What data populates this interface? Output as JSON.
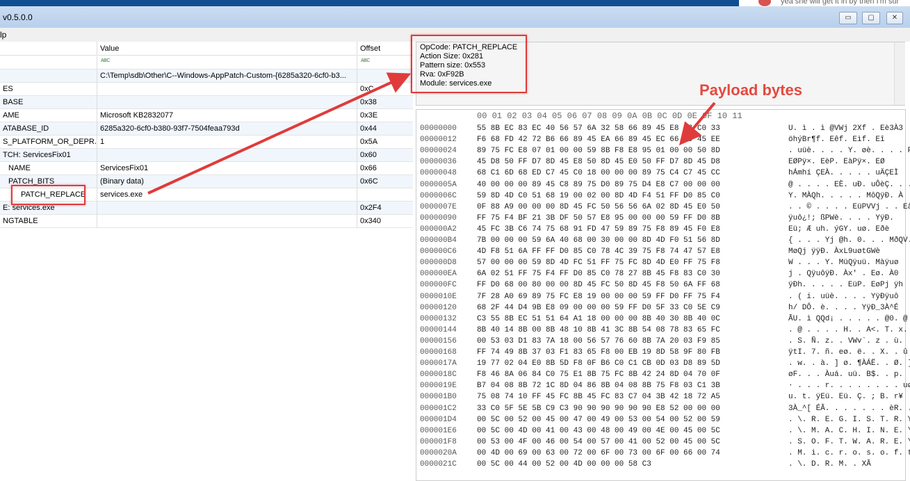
{
  "window": {
    "title": "v0.5.0.0",
    "chat_snippet": "yea she will get it in by then I'm sur",
    "buttons": {
      "minimize": "▭",
      "maximize": "▢",
      "close": "✕"
    }
  },
  "menu": {
    "help": "lp"
  },
  "grid": {
    "headers": {
      "name": "",
      "value": "Value",
      "offset": "Offset"
    },
    "rows": [
      {
        "name": "",
        "value": "",
        "value_icon": "abc-icon",
        "offset": "",
        "offset_icon": "abc-icon"
      },
      {
        "name": "",
        "value": "C:\\Temp\\sdb\\Other\\C--Windows-AppPatch-Custom-{6285a320-6cf0-b3...",
        "offset": ""
      },
      {
        "name": "ES",
        "value": "",
        "offset": "0xC"
      },
      {
        "name": "BASE",
        "value": "",
        "offset": "0x38"
      },
      {
        "name": "AME",
        "value": "Microsoft KB2832077",
        "offset": "0x3E"
      },
      {
        "name": "ATABASE_ID",
        "value": "6285a320-6cf0-b380-93f7-7504feaa793d",
        "offset": "0x44"
      },
      {
        "name": "S_PLATFORM_OR_DEPR...",
        "value": "1",
        "offset": "0x5A"
      },
      {
        "name": "TCH: ServicesFix01",
        "value": "",
        "offset": "0x60"
      },
      {
        "name": "NAME",
        "value": "ServicesFix01",
        "offset": "0x66"
      },
      {
        "name": "PATCH_BITS",
        "value": "(Binary data)",
        "offset": "0x6C"
      },
      {
        "name": "PATCH_REPLACE",
        "value": "services.exe",
        "offset": ""
      },
      {
        "name": "E: services.exe",
        "value": "",
        "offset": "0x2F4"
      },
      {
        "name": "NGTABLE",
        "value": "",
        "offset": "0x340"
      }
    ]
  },
  "info": {
    "lines": [
      "OpCode: PATCH_REPLACE",
      "Action Size: 0x281",
      "Pattern size: 0x553",
      "Rva: 0xF92B",
      "Module: services.exe"
    ]
  },
  "annotation": {
    "payload_label": "Payload bytes"
  },
  "hex": {
    "col_header": "00 01 02 03 04 05 06 07 08 09 0A 0B 0C 0D 0E 0F 10 11",
    "rows": [
      {
        "addr": "00000000",
        "bytes": "55 8B EC 83 EC 40 56 57 6A 32 58 66 89 45 E8 33 C0 33",
        "ascii": "U. ì . ì @VWj 2Xf . Eè3À3"
      },
      {
        "addr": "00000012",
        "bytes": "F6 68 FD 42 72 B6 66 89 45 EA 66 89 45 EC 66 89 45 EE",
        "ascii": "öhýBr¶f. Eêf. Eìf. Eî"
      },
      {
        "addr": "00000024",
        "bytes": "89 75 FC E8 07 01 00 00 59 8B F8 E8 95 01 00 00 50 8D",
        "ascii": ". uüè. . . . Y. øè. . . . P."
      },
      {
        "addr": "00000036",
        "bytes": "45 D8 50 FF D7 8D 45 E8 50 8D 45 E0 50 FF D7 8D 45 D8",
        "ascii": "EØPÿ×. EèP. EàPÿ×. EØ"
      },
      {
        "addr": "00000048",
        "bytes": "68 C1 6D 68 ED C7 45 C0 18 00 00 00 89 75 C4 C7 45 CC",
        "ascii": "hÁmhí ÇEÀ. . . . . uÄÇEÌ"
      },
      {
        "addr": "0000005A",
        "bytes": "40 00 00 00 89 45 C8 89 75 D0 89 75 D4 E8 C7 00 00 00",
        "ascii": "@ . . . . EÈ. uÐ. uÔèÇ. . ."
      },
      {
        "addr": "0000006C",
        "bytes": "59 8D 4D C0 51 68 19 00 02 00 8D 4D F4 51 FF D0 85 C0",
        "ascii": "Y. MÀQh. . . . . MôQÿÐ. À"
      },
      {
        "addr": "0000007E",
        "bytes": "0F 88 A9 00 00 00 8D 45 FC 50 56 56 6A 02 8D 45 E0 50",
        "ascii": ". . © . . . . EüPVVj . . EàP"
      },
      {
        "addr": "00000090",
        "bytes": "FF 75 F4 BF 21 3B DF 50 57 E8 95 00 00 00 59 FF D0 8B",
        "ascii": "ÿuô¿!; ßPWè. . . . YÿÐ."
      },
      {
        "addr": "000000A2",
        "bytes": "45 FC 3B C6 74 75 68 91 FD 47 59 89 75 F8 89 45 F0 E8",
        "ascii": "Eü; Æ uh. ýGY. uø. Eðè"
      },
      {
        "addr": "000000B4",
        "bytes": "7B 00 00 00 59 6A 40 68 00 30 00 00 8D 4D F0 51 56 8D",
        "ascii": "{ . . . Yj @h. 0. . . MðQV."
      },
      {
        "addr": "000000C6",
        "bytes": "4D F8 51 6A FF FF D0 85 C0 78 4C 39 75 F8 74 47 57 E8",
        "ascii": "MøQj ÿÿÐ. ÀxL9uøtGWè"
      },
      {
        "addr": "000000D8",
        "bytes": "57 00 00 00 59 8D 4D FC 51 FF 75 FC 8D 4D E0 FF 75 F8",
        "ascii": "W . . . Y. MüQÿuü. Màÿuø"
      },
      {
        "addr": "000000EA",
        "bytes": "6A 02 51 FF 75 F4 FF D0 85 C0 78 27 8B 45 F8 83 C0 30",
        "ascii": "j . QÿuôÿÐ. Àx' . Eø. À0"
      },
      {
        "addr": "000000FC",
        "bytes": "FF D0 68 00 80 00 00 8D 45 FC 50 8D 45 F8 50 6A FF 68",
        "ascii": "ÿÐh. . . . . EüP. EøPj ÿh"
      },
      {
        "addr": "0000010E",
        "bytes": "7F 28 A0 69 89 75 FC E8 19 00 00 00 59 FF D0 FF 75 F4",
        "ascii": ". ( i. uüè. . . . YÿÐÿuô"
      },
      {
        "addr": "00000120",
        "bytes": "68 2F 44 D4 9B E8 09 00 00 00 59 FF D0 5F 33 C0 5E C9",
        "ascii": "h/ DÔ. è. . . . YÿÐ_3À^É"
      },
      {
        "addr": "00000132",
        "bytes": "C3 55 8B EC 51 51 64 A1 18 00 00 00 8B 40 30 8B 40 0C",
        "ascii": "ÃU. ì QQd¡ . . . . . @0. @ ."
      },
      {
        "addr": "00000144",
        "bytes": "8B 40 14 8B 00 8B 48 10 8B 41 3C 8B 54 08 78 83 65 FC",
        "ascii": ". @ . . . . H. . A<. T. x. eü"
      },
      {
        "addr": "00000156",
        "bytes": "00 53 03 D1 83 7A 18 00 56 57 76 60 8B 7A 20 03 F9 85",
        "ascii": ". S. Ñ. z. . VWv`. z . ù."
      },
      {
        "addr": "00000168",
        "bytes": "FF 74 49 8B 37 03 F1 83 65 F8 00 EB 19 8D 58 9F 80 FB",
        "ascii": "ÿtI. 7. ñ. eø. ë. . X. . û"
      },
      {
        "addr": "0000017A",
        "bytes": "19 77 02 04 E0 8B 5D F8 0F B6 C0 C1 CB 0D 03 D8 89 5D",
        "ascii": ". w. . à. ] ø. ¶ÀÁË. . Ø. ]"
      },
      {
        "addr": "0000018C",
        "bytes": "F8 46 8A 06 84 C0 75 E1 8B 75 FC 8B 42 24 8D 04 70 0F",
        "ascii": "øF. . . Àuá. uü. B$. . p."
      },
      {
        "addr": "0000019E",
        "bytes": "B7 04 08 8B 72 1C 8D 04 86 8B 04 08 8B 75 F8 03 C1 3B",
        "ascii": "· . . . r. . . . . . . . uø. Á;"
      },
      {
        "addr": "000001B0",
        "bytes": "75 08 74 10 FF 45 FC 8B 45 FC 83 C7 04 3B 42 18 72 A5",
        "ascii": "u. t. ÿEü. Eü. Ç. ; B. r¥"
      },
      {
        "addr": "000001C2",
        "bytes": "33 C0 5F 5E 5B C9 C3 90 90 90 90 90 90 E8 52 00 00 00",
        "ascii": "3À_^[ ÉÃ. . . . . . . èR. . ."
      },
      {
        "addr": "000001D4",
        "bytes": "00 5C 00 52 00 45 00 47 00 49 00 53 00 54 00 52 00 59",
        "ascii": ". \\. R. E. G. I. S. T. R. Y"
      },
      {
        "addr": "000001E6",
        "bytes": "00 5C 00 4D 00 41 00 43 00 48 00 49 00 4E 00 45 00 5C",
        "ascii": ". \\. M. A. C. H. I. N. E. \\"
      },
      {
        "addr": "000001F8",
        "bytes": "00 53 00 4F 00 46 00 54 00 57 00 41 00 52 00 45 00 5C",
        "ascii": ". S. O. F. T. W. A. R. E. \\"
      },
      {
        "addr": "0000020A",
        "bytes": "00 4D 00 69 00 63 00 72 00 6F 00 73 00 6F 00 66 00 74",
        "ascii": ". M. i. c. r. o. s. o. f. t"
      },
      {
        "addr": "0000021C",
        "bytes": "00 5C 00 44 00 52 00 4D 00 00 00 58 C3",
        "ascii": ". \\. D. R. M. . XÃ"
      }
    ]
  },
  "colors": {
    "annotation_red": "#e03b3b",
    "titlebar": "#c6daf1",
    "row_alt": "#f0f6fc"
  }
}
